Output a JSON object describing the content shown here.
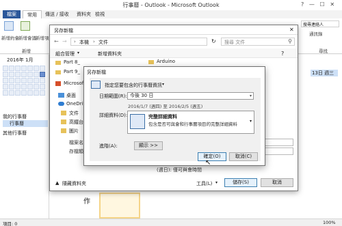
{
  "outlook": {
    "window_title": "行事曆 - Outlook - Microsoft Outlook",
    "tabs": [
      "檔案",
      "常用",
      "傳送 / 接收",
      "資料夾",
      "檢視"
    ],
    "ribbon_new_appointment": "新增約會",
    "ribbon_new_meeting": "新增會議",
    "ribbon_new_items": "新增項目",
    "ribbon_group_new": "新增",
    "ribbon_search_people": "搜尋連絡人",
    "ribbon_address_book": "通訊錄",
    "ribbon_group_find": "尋找",
    "mini_cal_header": "2016年 1月",
    "left_my_calendars": "我的行事曆",
    "left_calendar_item": "行事曆",
    "left_other_calendars": "其他行事曆",
    "grid_day_label": "13日 週三",
    "grid_char": "作",
    "status_items": "項目: 0",
    "zoom": "100%"
  },
  "saveas": {
    "title": "另存新檔",
    "address_path": [
      "本機",
      "文件"
    ],
    "search_placeholder": "搜尋 文件",
    "toolbar_organize": "組合管理",
    "toolbar_new_folder": "新增資料夾",
    "files": [
      "Arduino",
      "Part 8_",
      "Part 9_"
    ],
    "nav_items": [
      "Microsoft",
      "桌面",
      "OneDrive",
      "文件",
      "高鐵台",
      "圖片"
    ],
    "filename_label": "檔案名稱",
    "savetype_label": "存檔類型",
    "date_hint": "(週日): 僅可與會時間",
    "hide_folders": "隱藏資料夾",
    "tools_label": "工具(L)",
    "save_button": "儲存(S)",
    "cancel_button": "取消"
  },
  "options": {
    "title": "另存新檔",
    "header": "指定您要包含的行事曆資訊",
    "date_range_label": "日期範圍(R):",
    "date_range_value": "今後 30 日",
    "date_range_caption": "2016/1/7 (週四) 至 2016/2/5 (週五)",
    "detail_label": "詳細資料(D):",
    "detail_title": "完整詳細資料",
    "detail_desc": "包含是否可與會和行事曆項目的完整詳細資料",
    "advanced_label": "進階(A):",
    "show_button": "顯示 >>",
    "ok_button": "確定(O)",
    "cancel_button": "取消(C)"
  },
  "colors": {
    "file_tab": "#2b579a",
    "accent_blue": "#3c7fb1",
    "selected_day": "#6a8fd0"
  }
}
